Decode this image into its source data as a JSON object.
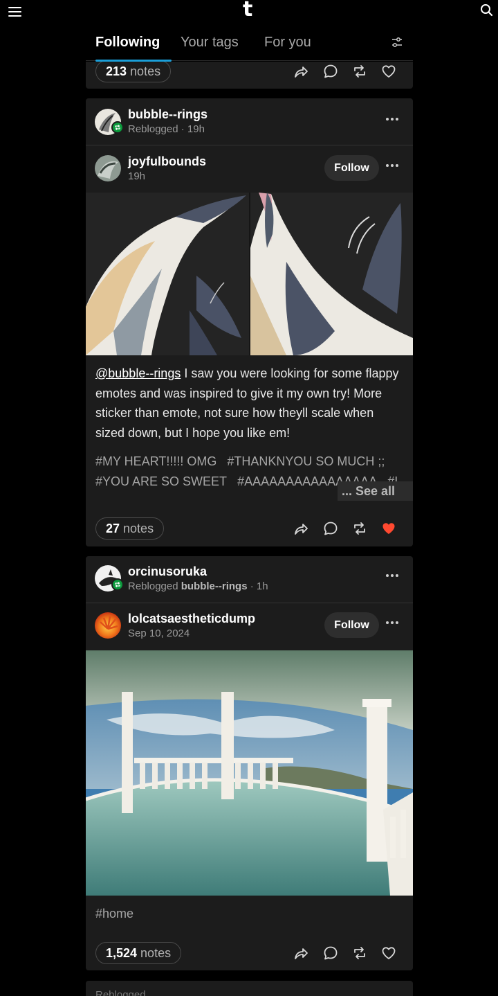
{
  "header": {
    "logo": "t"
  },
  "tabs": [
    {
      "label": "Following"
    },
    {
      "label": "Your tags"
    },
    {
      "label": "For you"
    }
  ],
  "post0": {
    "notes_count": "213",
    "notes_label": "notes"
  },
  "post1": {
    "reblogger": {
      "name": "bubble--rings",
      "meta": "Reblogged · 19h"
    },
    "author": {
      "name": "joyfulbounds",
      "time": "19h",
      "follow_label": "Follow"
    },
    "mention": "@bubble--rings",
    "text": "I saw you were looking for some flappy emotes and was inspired to give it my own try! More sticker than emote, not sure how theyll scale when sized down, but I hope you like em!",
    "tags": [
      "#MY HEART!!!!! OMG",
      "#THANKNYOU SO MUCH ;;",
      "#YOU ARE SO SWEET",
      "#AAAAAAAAAAAAAAAA",
      "#I LOVE THEM SO MUCH THANK YOU"
    ],
    "see_all": "... See all",
    "notes_count": "27",
    "notes_label": "notes",
    "liked": true
  },
  "post2": {
    "reblogger": {
      "name": "orcinusoruka",
      "meta_prefix": "Reblogged",
      "via": "bubble--rings",
      "meta_suffix": "· 1h"
    },
    "author": {
      "name": "lolcatsaestheticdump",
      "time": "Sep 10, 2024",
      "follow_label": "Follow"
    },
    "tags": [
      "#home"
    ],
    "notes_count": "1,524",
    "notes_label": "notes",
    "liked": false
  },
  "post3": {
    "meta_partial": "Reblogged  ..."
  },
  "colors": {
    "accent": "#1a9fd9",
    "like": "#ff4930",
    "reblog_badge": "#0b9a3c",
    "card_bg": "#1c1c1c"
  },
  "icons": [
    "menu-icon",
    "tumblr-logo",
    "search-icon",
    "filter-icon",
    "share-icon",
    "reply-icon",
    "reblog-icon",
    "heart-icon",
    "more-icon"
  ]
}
